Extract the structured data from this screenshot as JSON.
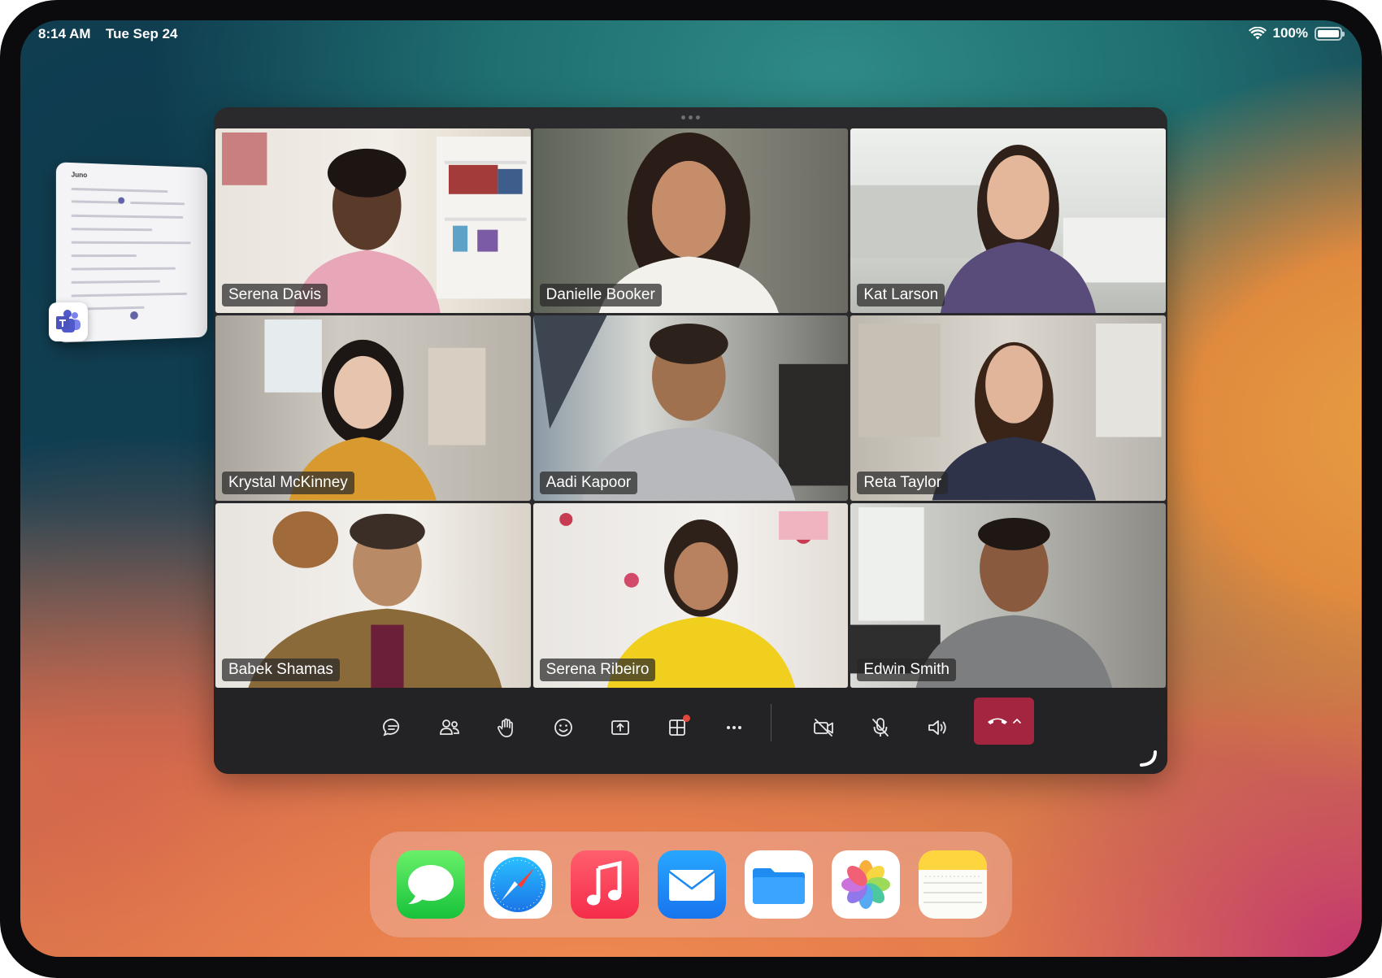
{
  "status_bar": {
    "time": "8:14 AM",
    "date": "Tue Sep 24",
    "battery": "100%",
    "wifi_icon": "wifi-icon",
    "battery_icon": "battery-icon"
  },
  "slideover": {
    "app": "Microsoft Teams",
    "mini_title": "Juno"
  },
  "meeting": {
    "participants": [
      {
        "name": "Serena Davis"
      },
      {
        "name": "Danielle Booker"
      },
      {
        "name": "Kat Larson"
      },
      {
        "name": "Krystal McKinney"
      },
      {
        "name": "Aadi Kapoor"
      },
      {
        "name": "Reta Taylor"
      },
      {
        "name": "Babek Shamas"
      },
      {
        "name": "Serena Ribeiro"
      },
      {
        "name": "Edwin Smith"
      }
    ],
    "controls": [
      {
        "name": "chat",
        "icon": "chat-icon"
      },
      {
        "name": "people",
        "icon": "people-icon"
      },
      {
        "name": "raise-hand",
        "icon": "raise-hand-icon"
      },
      {
        "name": "reactions",
        "icon": "emoji-icon"
      },
      {
        "name": "share",
        "icon": "share-screen-icon"
      },
      {
        "name": "apps",
        "icon": "apps-icon"
      },
      {
        "name": "more",
        "icon": "more-icon"
      },
      {
        "name": "camera",
        "icon": "camera-off-icon"
      },
      {
        "name": "mic",
        "icon": "mic-off-icon"
      },
      {
        "name": "speaker",
        "icon": "speaker-icon"
      },
      {
        "name": "leave",
        "icon": "hang-up-icon"
      }
    ],
    "leave_color": "#a3253f"
  },
  "dock": {
    "apps": [
      "Messages",
      "Safari",
      "Music",
      "Mail",
      "Files",
      "Photos",
      "Notes"
    ]
  }
}
